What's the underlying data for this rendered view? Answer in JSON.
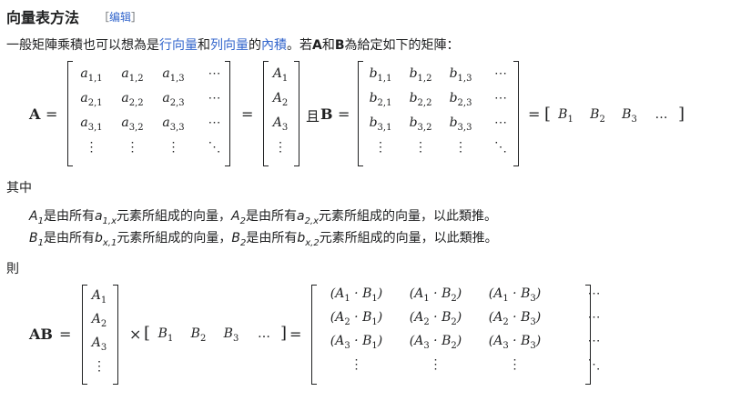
{
  "section": {
    "heading": "向量表方法",
    "edit_open": "［",
    "edit_label": "编辑",
    "edit_close": "］"
  },
  "intro": {
    "part1": "一般矩陣乘積也可以想為是",
    "link_row": "行向量",
    "and": "和",
    "link_col": "列向量",
    "of": "的",
    "link_inner": "內積",
    "part2": "。若",
    "A": "A",
    "he": "和",
    "B": "B",
    "part3": "為給定如下的矩陣："
  },
  "eq1": {
    "lhsA": "A",
    "eq": "=",
    "matrixA": [
      [
        "a1,1",
        "a1,2",
        "a1,3",
        "⋯"
      ],
      [
        "a2,1",
        "a2,2",
        "a2,3",
        "⋯"
      ],
      [
        "a3,1",
        "a3,2",
        "a3,3",
        "⋯"
      ],
      [
        "⋮",
        "⋮",
        "⋮",
        "⋱"
      ]
    ],
    "colA": [
      "A1",
      "A2",
      "A3",
      "⋮"
    ],
    "qie": "且",
    "lhsB": "B",
    "matrixB": [
      [
        "b1,1",
        "b1,2",
        "b1,3",
        "⋯"
      ],
      [
        "b2,1",
        "b2,2",
        "b2,3",
        "⋯"
      ],
      [
        "b3,1",
        "b3,2",
        "b3,3",
        "⋯"
      ],
      [
        "⋮",
        "⋮",
        "⋮",
        "⋱"
      ]
    ],
    "rowB": [
      "B1",
      "B2",
      "B3",
      "…"
    ]
  },
  "where_label": "其中",
  "notes": [
    {
      "v1": "A",
      "s1": "1",
      "t1": "是由所有",
      "v2": "a",
      "s2": "1,x",
      "t2": "元素所組成的向量，",
      "v3": "A",
      "s3": "2",
      "t3": "是由所有",
      "v4": "a",
      "s4": "2,x",
      "t4": "元素所組成的向量，以此類推。"
    },
    {
      "v1": "B",
      "s1": "1",
      "t1": "是由所有",
      "v2": "b",
      "s2": "x,1",
      "t2": "元素所組成的向量，",
      "v3": "B",
      "s3": "2",
      "t3": "是由所有",
      "v4": "b",
      "s4": "x,2",
      "t4": "元素所組成的向量，以此類推。"
    }
  ],
  "then_label": "則",
  "eq2": {
    "lhs": "AB",
    "eq": "=",
    "times": "×",
    "col": [
      "A1",
      "A2",
      "A3",
      "⋮"
    ],
    "row": [
      "B1",
      "B2",
      "B3",
      "…"
    ],
    "result": [
      [
        "(A1 · B1)",
        "(A1 · B2)",
        "(A1 · B3)",
        "⋯"
      ],
      [
        "(A2 · B1)",
        "(A2 · B2)",
        "(A2 · B3)",
        "⋯"
      ],
      [
        "(A3 · B1)",
        "(A3 · B2)",
        "(A3 · B3)",
        "⋯"
      ],
      [
        "⋮",
        "⋮",
        "⋮",
        "⋱"
      ]
    ]
  }
}
